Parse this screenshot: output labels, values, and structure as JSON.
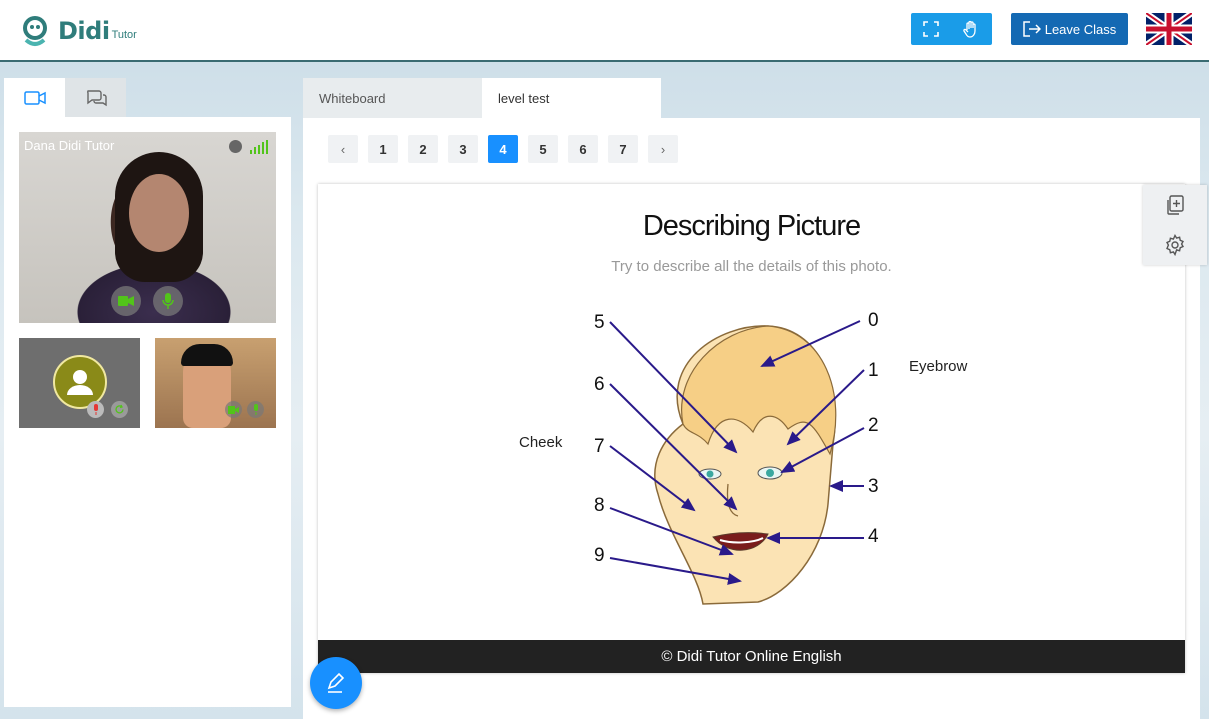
{
  "header": {
    "logo_text": "Didi",
    "logo_sub": "Tutor",
    "leave_label": "Leave Class",
    "language": "English (UK flag)"
  },
  "sidebar": {
    "tabs": [
      {
        "icon": "video-camera-icon"
      },
      {
        "icon": "chat-icon"
      }
    ],
    "main_video": {
      "name": "Dana Didi Tutor"
    }
  },
  "content_tabs": [
    "Whiteboard",
    "level test"
  ],
  "pager": {
    "prev": "‹",
    "next": "›",
    "pages": [
      "1",
      "2",
      "3",
      "4",
      "5",
      "6",
      "7"
    ],
    "current": "4"
  },
  "slide": {
    "title": "Describing Picture",
    "subtitle": "Try to describe all the details of this photo.",
    "labels": {
      "cheek": "Cheek",
      "eyebrow": "Eyebrow"
    },
    "numbers": [
      "0",
      "1",
      "2",
      "3",
      "4",
      "5",
      "6",
      "7",
      "8",
      "9"
    ],
    "footer": "© Didi Tutor Online English"
  },
  "colors": {
    "accent": "#1890ff",
    "leave": "#1469b3",
    "brand": "#2f7d7b"
  }
}
